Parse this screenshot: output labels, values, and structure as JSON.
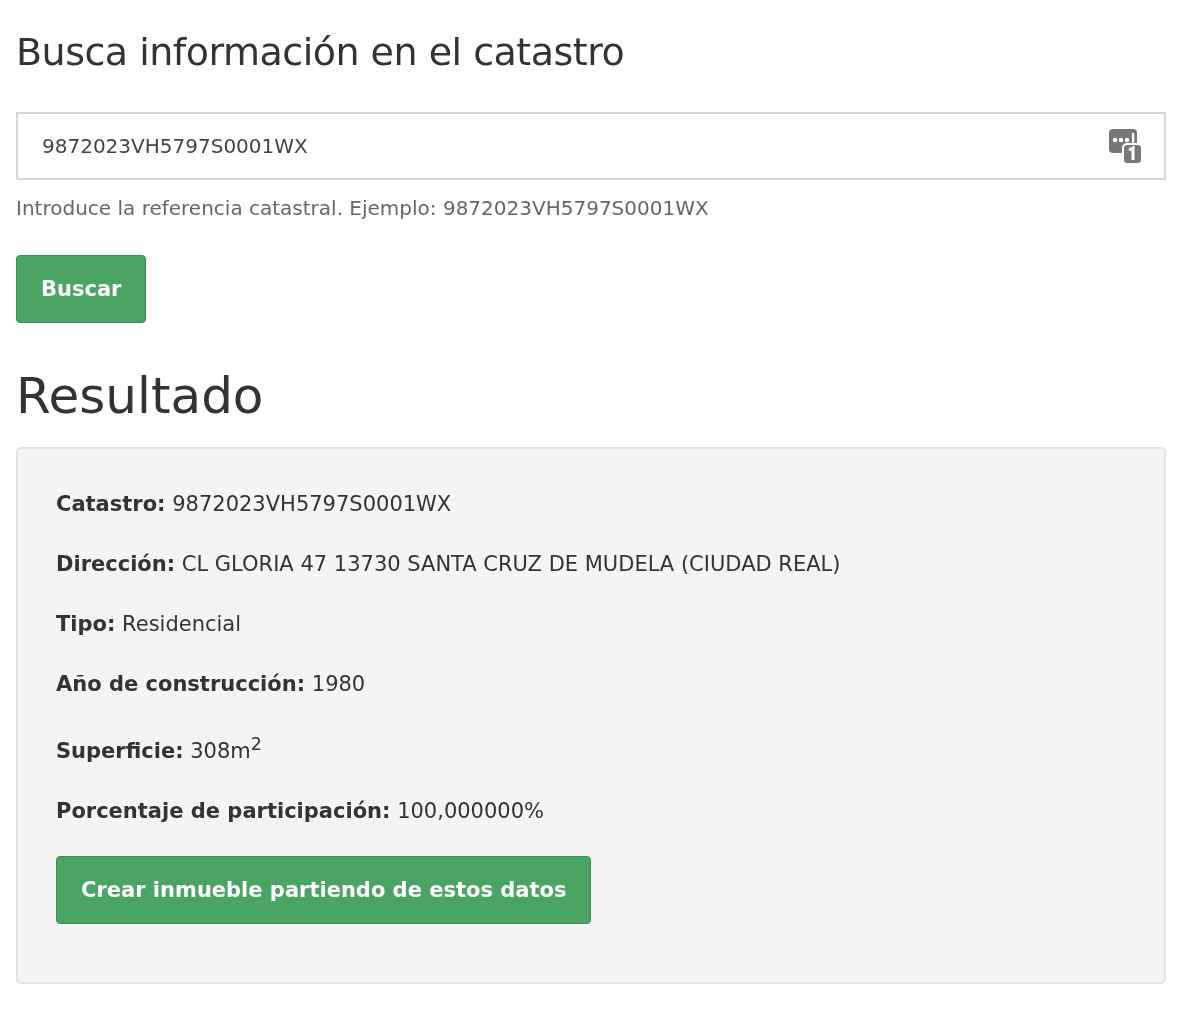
{
  "title": "Busca información en el catastro",
  "search": {
    "value": "9872023VH5797S0001WX",
    "help": "Introduce la referencia catastral. Ejemplo: 9872023VH5797S0001WX",
    "button": "Buscar"
  },
  "result": {
    "heading": "Resultado",
    "fields": [
      {
        "label": "Catastro:",
        "value": "9872023VH5797S0001WX"
      },
      {
        "label": "Dirección:",
        "value": "CL GLORIA 47 13730 SANTA CRUZ DE MUDELA (CIUDAD REAL)"
      },
      {
        "label": "Tipo:",
        "value": "Residencial"
      },
      {
        "label": "Año de construcción:",
        "value": "1980"
      },
      {
        "label": "Superficie:",
        "value": "308m$^{2}$"
      },
      {
        "label": "Porcentaje de participación:",
        "value": "100,000000%"
      }
    ],
    "button": "Crear inmueble partiendo de estos datos"
  }
}
